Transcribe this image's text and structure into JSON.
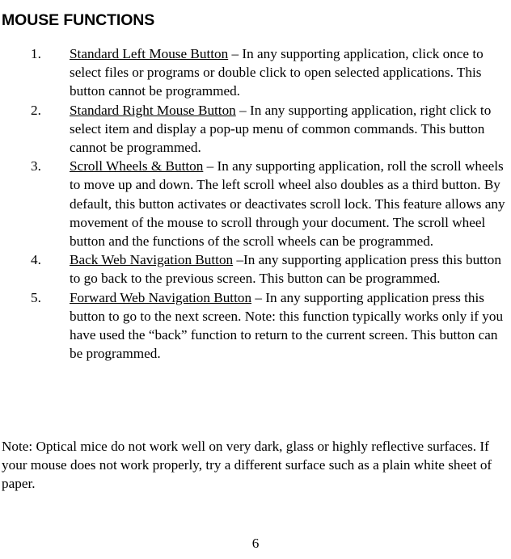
{
  "document": {
    "title": "MOUSE FUNCTIONS",
    "page_number": "6"
  },
  "functions_list": [
    {
      "number": "1.",
      "term": "Standard Left Mouse Button",
      "description": " – In any supporting application, click once to select files or programs or double click to open selected applications.  This button cannot be programmed."
    },
    {
      "number": "2.",
      "term": "Standard Right Mouse Button",
      "description": " – In any supporting application, right click to select item and display a pop-up menu of common commands. This button cannot be programmed."
    },
    {
      "number": "3.",
      "term": "Scroll Wheels & Button",
      "description": " – In any supporting application, roll the scroll wheels to move up and down. The left scroll wheel also doubles as a third button.  By default, this button activates or deactivates scroll lock. This feature allows any movement of the mouse to scroll through your document.  The scroll wheel button and the functions of the scroll wheels can be programmed."
    },
    {
      "number": "4.",
      "term": "Back Web Navigation Button",
      "description": " –In any supporting application press this button to go back to the previous screen. This button can be programmed."
    },
    {
      "number": "5.",
      "term": "Forward Web Navigation Button",
      "description": " – In any supporting application press this button to go to the next screen. Note: this function typically works only if you have used the “back” function to return to the current screen.  This button can be programmed."
    }
  ],
  "note": {
    "text": "Note: Optical mice do not work well on very dark, glass or highly reflective surfaces. If your mouse does not work properly, try a different surface such as a plain white sheet of paper."
  }
}
